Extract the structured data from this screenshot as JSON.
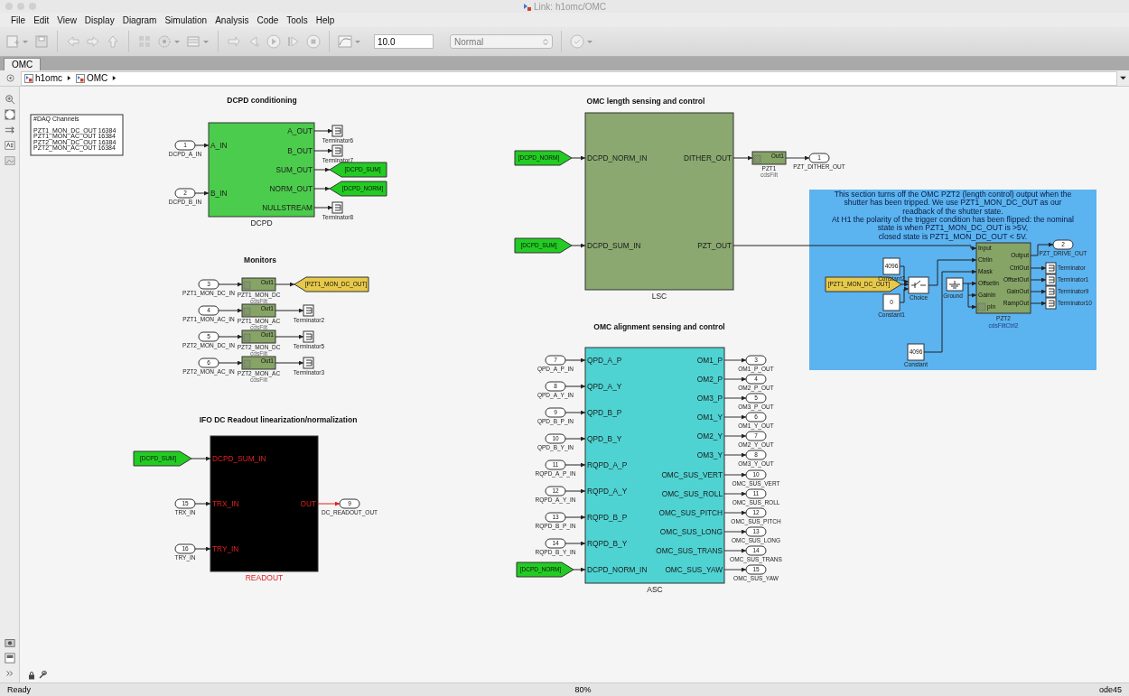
{
  "window": {
    "title": "Link: h1omc/OMC"
  },
  "menu": [
    "File",
    "Edit",
    "View",
    "Display",
    "Diagram",
    "Simulation",
    "Analysis",
    "Code",
    "Tools",
    "Help"
  ],
  "toolbar": {
    "stop_time": "10.0",
    "mode": "Normal"
  },
  "tabs": [
    {
      "label": "OMC",
      "selected": true
    }
  ],
  "breadcrumb": [
    "h1omc",
    "OMC"
  ],
  "canvas": {
    "daq_note": [
      "#DAQ Channels",
      "PZT1_MON_DC_OUT 16384",
      "PZT1_MON_AC_OUT 16384",
      "PZT2_MON_DC_OUT 16384",
      "PZT2_MON_AC_OUT 16384"
    ],
    "section_titles": [
      "DCPD conditioning",
      "Monitors",
      "IFO DC Readout linearization/normalization",
      "OMC length sensing and control",
      "OMC alignment sensing and control"
    ],
    "subsystems": [
      {
        "name": "DCPD",
        "color": "#4ccc4c",
        "kind": "light",
        "inputs": [
          "A_IN",
          "B_IN"
        ],
        "outputs": [
          "A_OUT",
          "B_OUT",
          "SUM_OUT",
          "NORM_OUT",
          "NULLSTREAM"
        ]
      },
      {
        "name": "LSC",
        "color": "#8aa870",
        "kind": "light",
        "inputs": [
          "DCPD_NORM_IN",
          "DCPD_SUM_IN"
        ],
        "outputs": [
          "DITHER_OUT",
          "PZT_OUT"
        ]
      },
      {
        "name": "ASC",
        "color": "#4fd2d2",
        "kind": "light",
        "inputs": [
          "QPD_A_P",
          "QPD_A_Y",
          "QPD_B_P",
          "QPD_B_Y",
          "RQPD_A_P",
          "RQPD_A_Y",
          "RQPD_B_P",
          "RQPD_B_Y",
          "DCPD_NORM_IN"
        ],
        "outputs": [
          "OM1_P",
          "OM2_P",
          "OM3_P",
          "OM1_Y",
          "OM2_Y",
          "OM3_Y",
          "OMC_SUS_VERT",
          "OMC_SUS_ROLL",
          "OMC_SUS_PITCH",
          "OMC_SUS_LONG",
          "OMC_SUS_TRANS",
          "OMC_SUS_YAW"
        ]
      },
      {
        "name": "READOUT",
        "color": "#000000",
        "kind": "dark",
        "inputs": [
          "DCPD_SUM_IN",
          "TRX_IN",
          "TRY_IN"
        ],
        "outputs": [
          "OUT"
        ]
      }
    ],
    "inports": [
      {
        "number": "1",
        "label": "DCPD_A_IN"
      },
      {
        "number": "2",
        "label": "DCPD_B_IN"
      },
      {
        "number": "3",
        "label": "PZT1_MON_DC_IN"
      },
      {
        "number": "4",
        "label": "PZT1_MON_AC_IN"
      },
      {
        "number": "5",
        "label": "PZT2_MON_DC_IN"
      },
      {
        "number": "6",
        "label": "PZT2_MON_AC_IN"
      },
      {
        "number": "15",
        "label": "TRX_IN"
      },
      {
        "number": "16",
        "label": "TRY_IN"
      },
      {
        "number": "7",
        "label": "QPD_A_P_IN"
      },
      {
        "number": "8",
        "label": "QPD_A_Y_IN"
      },
      {
        "number": "9",
        "label": "QPD_B_P_IN"
      },
      {
        "number": "10",
        "label": "QPD_B_Y_IN"
      },
      {
        "number": "11",
        "label": "RQPD_A_P_IN"
      },
      {
        "number": "12",
        "label": "RQPD_A_Y_IN"
      },
      {
        "number": "13",
        "label": "RQPD_B_P_IN"
      },
      {
        "number": "14",
        "label": "RQPD_B_Y_IN"
      }
    ],
    "outports": [
      {
        "number": "1",
        "label": "PZT_DITHER_OUT"
      },
      {
        "number": "9",
        "label": "DC_READOUT_OUT"
      },
      {
        "number": "2",
        "label": "PZT_DRIVE_OUT"
      },
      {
        "number": "3",
        "label": "OM1_P_OUT"
      },
      {
        "number": "4",
        "label": "OM2_P_OUT"
      },
      {
        "number": "5",
        "label": "OM3_P_OUT"
      },
      {
        "number": "6",
        "label": "OM1_Y_OUT"
      },
      {
        "number": "7",
        "label": "OM2_Y_OUT"
      },
      {
        "number": "8",
        "label": "OM3_Y_OUT"
      },
      {
        "number": "10",
        "label": "OMC_SUS_VERT"
      },
      {
        "number": "11",
        "label": "OMC_SUS_ROLL"
      },
      {
        "number": "12",
        "label": "OMC_SUS_PITCH"
      },
      {
        "number": "13",
        "label": "OMC_SUS_LONG"
      },
      {
        "number": "14",
        "label": "OMC_SUS_TRANS"
      },
      {
        "number": "15",
        "label": "OMC_SUS_YAW"
      }
    ],
    "tags": [
      {
        "kind": "goto",
        "text": "[DCPD_SUM]",
        "color": "#22cc22"
      },
      {
        "kind": "goto",
        "text": "[DCPD_NORM]",
        "color": "#22cc22"
      },
      {
        "kind": "goto",
        "text": "[PZT1_MON_DC_OUT]",
        "color": "#e6c84a"
      },
      {
        "kind": "from",
        "text": "[DCPD_NORM]",
        "color": "#22cc22"
      },
      {
        "kind": "from",
        "text": "[DCPD_SUM]",
        "color": "#22cc22"
      },
      {
        "kind": "from",
        "text": "[DCPD_SUM]",
        "color": "#22cc22"
      },
      {
        "kind": "from",
        "text": "[DCPD_NORM]",
        "color": "#22cc22"
      },
      {
        "kind": "from",
        "text": "[PZT1_MON_DC_OUT]",
        "color": "#e6c84a"
      }
    ],
    "filters": [
      {
        "name": "PZT1_MON_DC",
        "library": "cdsFilt",
        "port": "Out1"
      },
      {
        "name": "PZT1_MON_AC",
        "library": "cdsFilt",
        "port": "Out1"
      },
      {
        "name": "PZT2_MON_DC",
        "library": "cdsFilt",
        "port": "Out1"
      },
      {
        "name": "PZT2_MON_AC",
        "library": "cdsFilt",
        "port": "Out1"
      },
      {
        "name": "PZT1",
        "library": "cdsFilt",
        "port": "Out1"
      }
    ],
    "terminators": [
      "Terminator6",
      "Terminator7",
      "Terminator8",
      "Terminator2",
      "Terminator5",
      "Terminator3",
      "Terminator",
      "Terminator1",
      "Terminator9",
      "Terminator10"
    ],
    "shutter_note": {
      "lines": [
        "This section turns off the OMC PZT2 (length control) output when the",
        "shutter has been tripped.  We use PZT1_MON_DC_OUT as our",
        "readback of the shutter state.",
        "At H1 the polarity of the trigger condition has been flipped: the nominal",
        "state is when PZT1_MON_DC_OUT is >5V,",
        "closed state is PZT1_MON_DC_OUT < 5V."
      ],
      "constants": [
        {
          "value": "4096",
          "name": "Constant2"
        },
        {
          "value": "0",
          "name": "Constant1"
        },
        {
          "value": "4096",
          "name": "Constant"
        }
      ],
      "switch": "Choice",
      "ground": "Ground",
      "controller": {
        "name": "PZT2",
        "library": "cdsFiltCtrl2",
        "inputs": [
          "Input",
          "CtrlIn",
          "Mask",
          "OffsetIn",
          "GainIn",
          "pIn"
        ],
        "outputs": [
          "Output",
          "CtrlOut",
          "OffsetOut",
          "GainOut",
          "RampOut"
        ]
      }
    }
  },
  "status_bar": {
    "state": "Ready",
    "zoom": "80%",
    "solver": "ode45"
  }
}
